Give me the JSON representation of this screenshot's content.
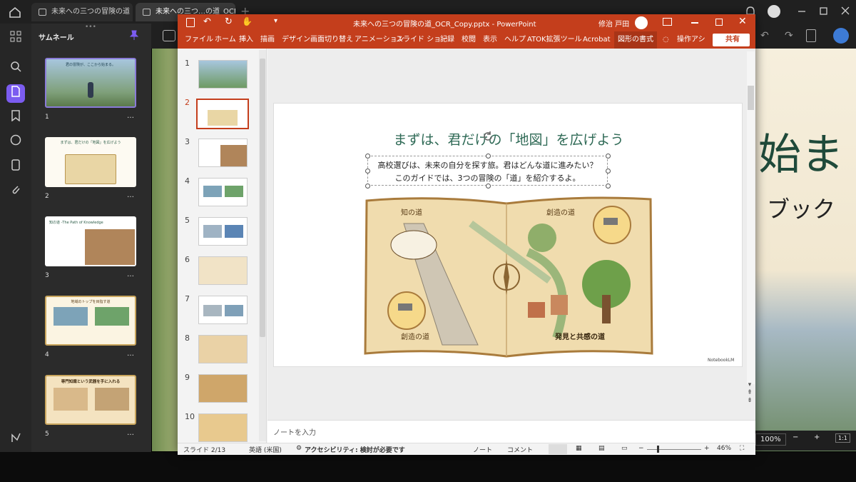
{
  "browser": {
    "tabs": [
      {
        "label": "未来への三つの冒険の道",
        "close": "×"
      },
      {
        "label": "未来への三つ…の道_OCR",
        "close": "×"
      }
    ],
    "new_tab": "+"
  },
  "thumbnail_panel": {
    "title": "サムネール",
    "items": [
      {
        "num": "1",
        "caption": "君の冒険が、ここから始まる。"
      },
      {
        "num": "2",
        "caption": "まずは、君だけの「地図」を広げよう"
      },
      {
        "num": "3",
        "caption": "知の道 -The Path of Knowledge"
      },
      {
        "num": "4",
        "caption": "地域のトップを目指す道"
      },
      {
        "num": "5",
        "caption": "専門知識という武器を手に入れる"
      }
    ],
    "more": "…"
  },
  "background_doc": {
    "heading_fragment": "始ま",
    "sub_fragment": "ブック",
    "zoom": "100%",
    "fit": "1:1",
    "minus": "−",
    "plus": "+"
  },
  "ppt": {
    "title": "未来への三つの冒険の道_OCR_Copy.pptx  -  PowerPoint",
    "user": "修治 戸田",
    "ribbon_tabs": [
      "ファイル",
      "ホーム",
      "挿入",
      "描画",
      "デザイン",
      "画面切り替え",
      "アニメーション",
      "スライド ショー",
      "記録",
      "校閲",
      "表示",
      "ヘルプ",
      "ATOK拡張ツール",
      "Acrobat",
      "図形の書式"
    ],
    "tell_me": "操作アシ",
    "share": "共有",
    "slide_numbers": [
      "1",
      "2",
      "3",
      "4",
      "5",
      "6",
      "7",
      "8",
      "9",
      "10"
    ],
    "slide": {
      "title": "まずは、君だけの「地図」を広げよう",
      "line1": "高校選びは、未来の自分を探す旅。君はどんな道に進みたい？",
      "line2": "このガイドでは、3つの冒険の「道」を紹介するよ。",
      "map_labels": [
        "知の道",
        "創造の道",
        "創造の道",
        "発見と共感の道"
      ],
      "watermark": "NotebookLM"
    },
    "notes_placeholder": "ノートを入力",
    "status": {
      "slide": "スライド 2/13",
      "lang": "英語 (米国)",
      "accessibility": "アクセシビリティ: 検討が必要です",
      "notes": "ノート",
      "comments": "コメント",
      "zoom": "46%"
    }
  }
}
